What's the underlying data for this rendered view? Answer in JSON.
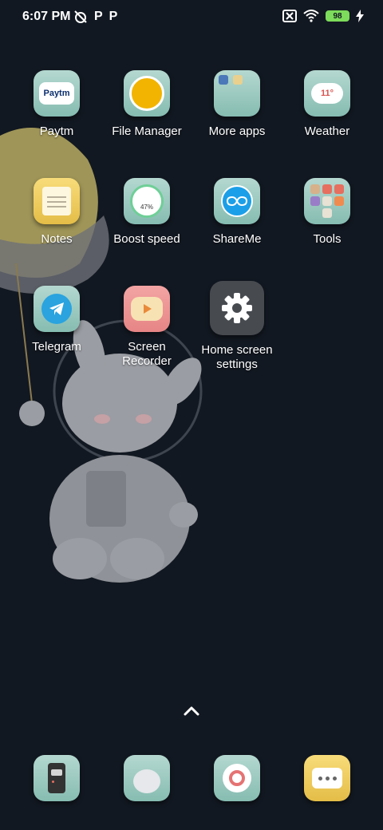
{
  "status": {
    "time": "6:07 PM",
    "notif_p1": "P",
    "notif_p2": "P",
    "battery": "98"
  },
  "apps": [
    {
      "label": "Paytm",
      "icon": "paytm-icon"
    },
    {
      "label": "File Manager",
      "icon": "file-manager-icon"
    },
    {
      "label": "More apps",
      "icon": "folder-icon"
    },
    {
      "label": "Weather",
      "icon": "weather-icon"
    },
    {
      "label": "Notes",
      "icon": "notes-icon"
    },
    {
      "label": "Boost speed",
      "icon": "boost-speed-icon"
    },
    {
      "label": "ShareMe",
      "icon": "shareme-icon"
    },
    {
      "label": "Tools",
      "icon": "folder-icon"
    },
    {
      "label": "Telegram",
      "icon": "telegram-icon"
    },
    {
      "label": "Screen\nRecorder",
      "icon": "screen-recorder-icon"
    },
    {
      "label": "Home screen\nsettings",
      "icon": "gear-icon"
    }
  ],
  "icon_text": {
    "paytm": "Paytm",
    "boost_percent": "47%",
    "weather_temp": "11°"
  },
  "dock": [
    {
      "icon": "walkie-talkie-icon"
    },
    {
      "icon": "bunny-icon"
    },
    {
      "icon": "chrome-icon"
    },
    {
      "icon": "messages-icon"
    }
  ],
  "colors": {
    "background": "#121821",
    "tile_teal": "#9ccbc1",
    "battery_green": "#7ddc5b"
  }
}
